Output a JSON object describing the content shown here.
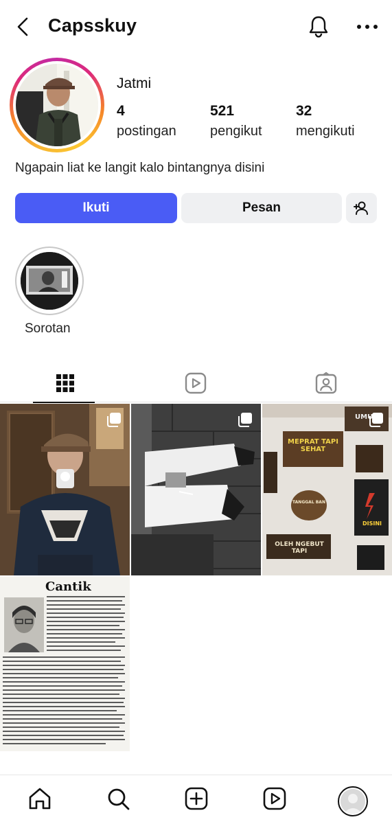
{
  "header": {
    "username": "Capsskuy",
    "icons": [
      "chevron-left-icon",
      "bell-icon",
      "more-dots-icon"
    ]
  },
  "profile": {
    "display_name": "Jatmi",
    "stats": [
      {
        "value": "4",
        "label": "postingan"
      },
      {
        "value": "521",
        "label": "pengikut"
      },
      {
        "value": "32",
        "label": "mengikuti"
      }
    ],
    "bio": "Ngapain liat ke langit kalo bintangnya disini"
  },
  "actions": {
    "follow": "Ikuti",
    "message": "Pesan",
    "add_icon": "person-add-icon"
  },
  "highlights": [
    {
      "label": "Sorotan"
    }
  ],
  "tabs": [
    {
      "name": "posts",
      "icon": "grid-icon",
      "active": true
    },
    {
      "name": "reels",
      "icon": "reels-icon",
      "active": false
    },
    {
      "name": "tagged",
      "icon": "tagged-icon",
      "active": false
    }
  ],
  "posts": [
    {
      "type": "mirror-selfie",
      "multi": true
    },
    {
      "type": "legs-sneakers",
      "multi": true
    },
    {
      "type": "wooden-signs",
      "multi": true,
      "sign_texts": [
        "MEPRAT TAPI SEHAT",
        "DISINI",
        "OLEH NGEBUT TAPI",
        "UMUR",
        "TANGGAL BAN"
      ]
    },
    {
      "type": "newspaper",
      "multi": false,
      "title": "Cantik"
    }
  ],
  "bottom_nav": [
    "home-icon",
    "search-icon",
    "create-icon",
    "reels-icon",
    "profile-avatar"
  ],
  "colors": {
    "accent": "#4a5cf5",
    "secondary_button": "#eff0f2",
    "text": "#111111"
  }
}
